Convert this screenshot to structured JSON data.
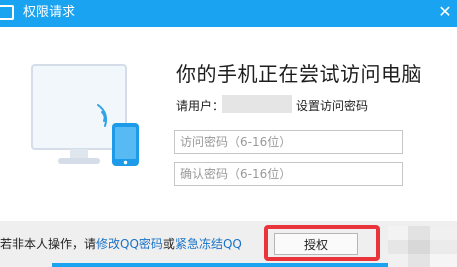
{
  "window": {
    "title": "权限请求"
  },
  "icons": {
    "title_icon": "tablet-icon",
    "close_icon": "close-icon",
    "illustration": "computer-phone-illustration"
  },
  "main": {
    "headline": "你的手机正在尝试访问电脑",
    "user_label": "请用户：",
    "set_password_text": "设置访问密码",
    "password_placeholder": "访问密码（6-16位）",
    "confirm_placeholder": "确认密码（6-16位）"
  },
  "footer": {
    "prefix": "若非本人操作，请",
    "link_modify": "修改QQ密码",
    "connector": "或",
    "link_freeze": "紧急冻结QQ",
    "authorize_label": "授权"
  },
  "colors": {
    "accent": "#1aa3f0",
    "link": "#1a73c7",
    "highlight": "#e8343a"
  }
}
